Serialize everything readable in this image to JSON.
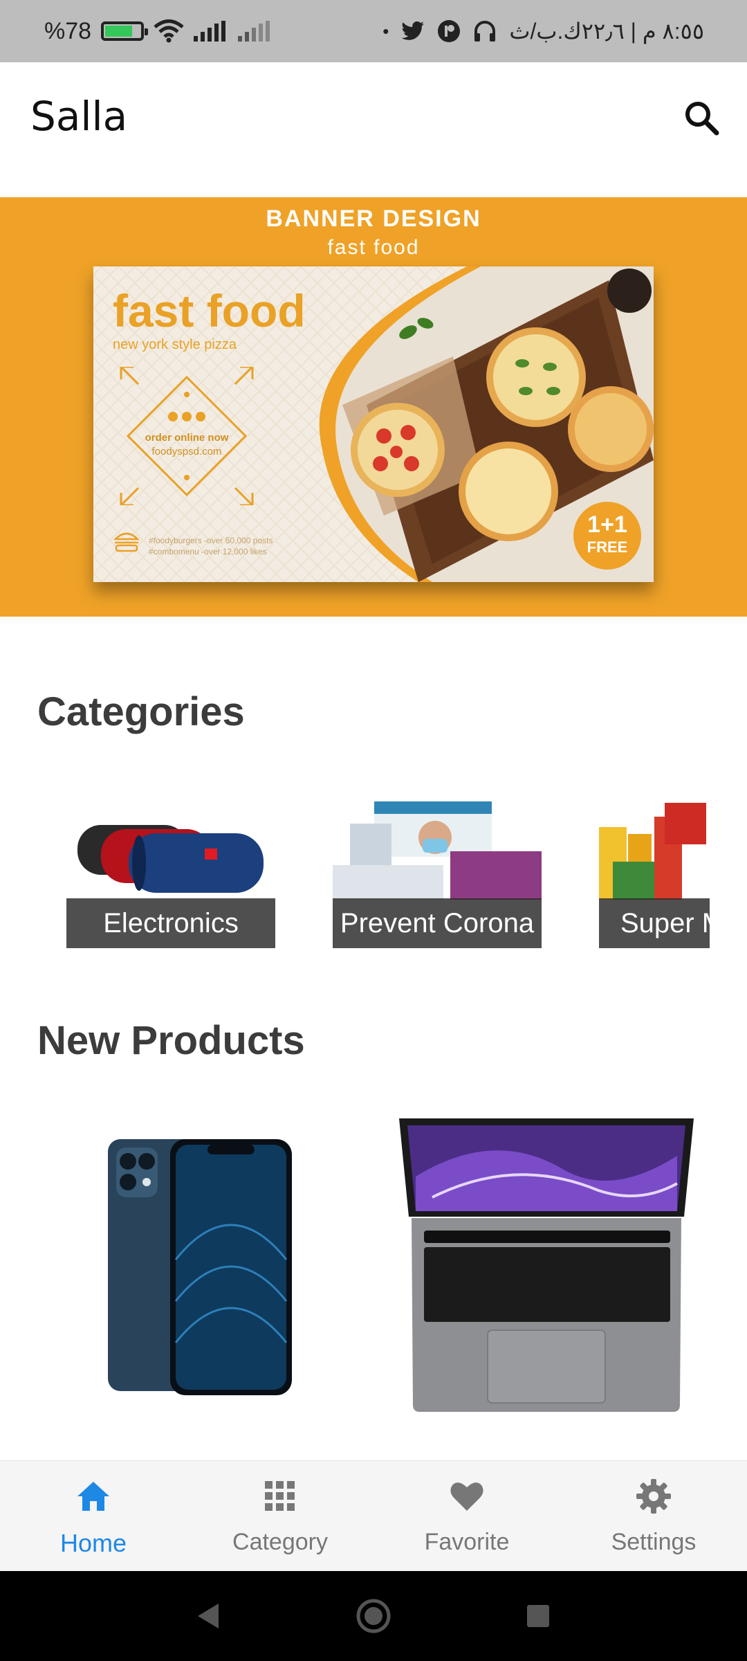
{
  "status_bar": {
    "battery_text": "%78",
    "right_text": "٨:٥٥ م | ٢٢٫٦ك.ب/ث"
  },
  "app_bar": {
    "title": "Salla",
    "search_icon": "search-icon"
  },
  "banner": {
    "heading": "BANNER DESIGN",
    "subheading": "fast food",
    "card_title": "fast food",
    "card_subtitle": "new york style pizza",
    "order_line1": "order online now",
    "order_line2": "foodyspsd.com",
    "hashtag1": "#foodyburgers -over 50,000 posts",
    "hashtag2": "#combomenu -over 12,000 likes",
    "badge_main": "1+1",
    "badge_sub": "FREE",
    "accent_color": "#efa227"
  },
  "categories": {
    "title": "Categories",
    "items": [
      {
        "label": "Electronics"
      },
      {
        "label": "Prevent Corona"
      },
      {
        "label": "Super Market"
      }
    ]
  },
  "new_products": {
    "title": "New Products"
  },
  "bottom_nav": {
    "items": [
      {
        "label": "Home",
        "icon": "home-icon",
        "active": true
      },
      {
        "label": "Category",
        "icon": "grid-icon",
        "active": false
      },
      {
        "label": "Favorite",
        "icon": "heart-icon",
        "active": false
      },
      {
        "label": "Settings",
        "icon": "gear-icon",
        "active": false
      }
    ],
    "active_color": "#1e88e5"
  }
}
